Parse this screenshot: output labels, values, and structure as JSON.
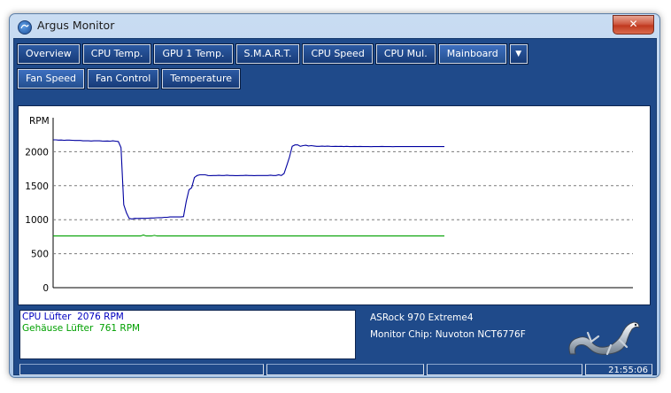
{
  "window": {
    "title": "Argus Monitor",
    "close_glyph": "✕"
  },
  "tabs_row1": [
    {
      "label": "Overview"
    },
    {
      "label": "CPU Temp."
    },
    {
      "label": "GPU 1 Temp."
    },
    {
      "label": "S.M.A.R.T."
    },
    {
      "label": "CPU Speed"
    },
    {
      "label": "CPU Mul."
    },
    {
      "label": "Mainboard",
      "active": true
    }
  ],
  "tabs_row1_more_glyph": "▼",
  "tabs_row2": [
    {
      "label": "Fan Speed",
      "active": true
    },
    {
      "label": "Fan Control"
    },
    {
      "label": "Temperature"
    }
  ],
  "chart_data": {
    "type": "line",
    "ylabel": "RPM",
    "yticks": [
      0,
      500,
      1000,
      1500,
      2000
    ],
    "ylim": [
      0,
      2500
    ],
    "grid": "horizontal-dashed",
    "series": [
      {
        "name": "CPU Lüfter",
        "color": "#0000a0",
        "values": [
          2175,
          2175,
          2170,
          2172,
          2168,
          2170,
          2170,
          2168,
          2165,
          2165,
          2165,
          2160,
          2160,
          2160,
          2158,
          2160,
          2160,
          2160,
          2158,
          2156,
          2158,
          2155,
          2160,
          2155,
          2150,
          2060,
          1220,
          1100,
          1020,
          1010,
          1020,
          1018,
          1020,
          1020,
          1020,
          1022,
          1025,
          1025,
          1028,
          1030,
          1030,
          1035,
          1035,
          1040,
          1040,
          1040,
          1040,
          1040,
          1045,
          1270,
          1440,
          1470,
          1620,
          1650,
          1660,
          1660,
          1660,
          1650,
          1648,
          1650,
          1650,
          1652,
          1650,
          1650,
          1655,
          1650,
          1650,
          1648,
          1648,
          1650,
          1650,
          1652,
          1650,
          1650,
          1648,
          1650,
          1650,
          1650,
          1650,
          1650,
          1655,
          1650,
          1650,
          1660,
          1650,
          1680,
          1800,
          1920,
          2080,
          2100,
          2100,
          2080,
          2090,
          2095,
          2085,
          2090,
          2085,
          2080,
          2080,
          2082,
          2080,
          2082,
          2080,
          2078,
          2080,
          2078,
          2080,
          2076,
          2080,
          2076,
          2076,
          2078,
          2076,
          2078,
          2075,
          2076,
          2076,
          2074,
          2076,
          2076,
          2075,
          2078,
          2076,
          2076,
          2076,
          2074,
          2076,
          2076,
          2076,
          2075,
          2076,
          2076,
          2076,
          2076,
          2076,
          2076,
          2076,
          2076,
          2076,
          2076,
          2076,
          2076,
          2076,
          2076,
          2076
        ]
      },
      {
        "name": "Gehäuse Lüfter",
        "color": "#00a000",
        "values": [
          761,
          760,
          761,
          762,
          761,
          760,
          761,
          760,
          761,
          762,
          761,
          760,
          761,
          761,
          762,
          761,
          760,
          761,
          761,
          760,
          761,
          761,
          760,
          761,
          761,
          761,
          760,
          761,
          761,
          762,
          761,
          760,
          761,
          775,
          761,
          762,
          761,
          770,
          761,
          760,
          761,
          761,
          762,
          761,
          760,
          761,
          761,
          760,
          761,
          761,
          760,
          761,
          762,
          761,
          761,
          760,
          761,
          761,
          760,
          761,
          761,
          762,
          761,
          760,
          761,
          761,
          760,
          761,
          761,
          762,
          761,
          760,
          761,
          761,
          760,
          761,
          761,
          760,
          761,
          761,
          762,
          761,
          760,
          761,
          761,
          760,
          761,
          762,
          761,
          760,
          761,
          761,
          762,
          761,
          760,
          761,
          761,
          760,
          761,
          761,
          760,
          761,
          761,
          762,
          761,
          760,
          761,
          761,
          760,
          761,
          761,
          760,
          761,
          762,
          761,
          760,
          761,
          761,
          760,
          761,
          761,
          760,
          761,
          761,
          762,
          761,
          760,
          761,
          761,
          760,
          761,
          761,
          762,
          761,
          760,
          761,
          761,
          760,
          761,
          761,
          760,
          761,
          761,
          761
        ]
      }
    ]
  },
  "readings": [
    {
      "name": "CPU Lüfter",
      "value": "2076 RPM",
      "color": "#0000c0"
    },
    {
      "name": "Gehäuse Lüfter",
      "value": "761 RPM",
      "color": "#00a000"
    }
  ],
  "board": {
    "name": "ASRock 970 Extreme4",
    "chip": "Monitor Chip: Nuvoton NCT6776F"
  },
  "statusbar": {
    "time": "21:55:06"
  }
}
